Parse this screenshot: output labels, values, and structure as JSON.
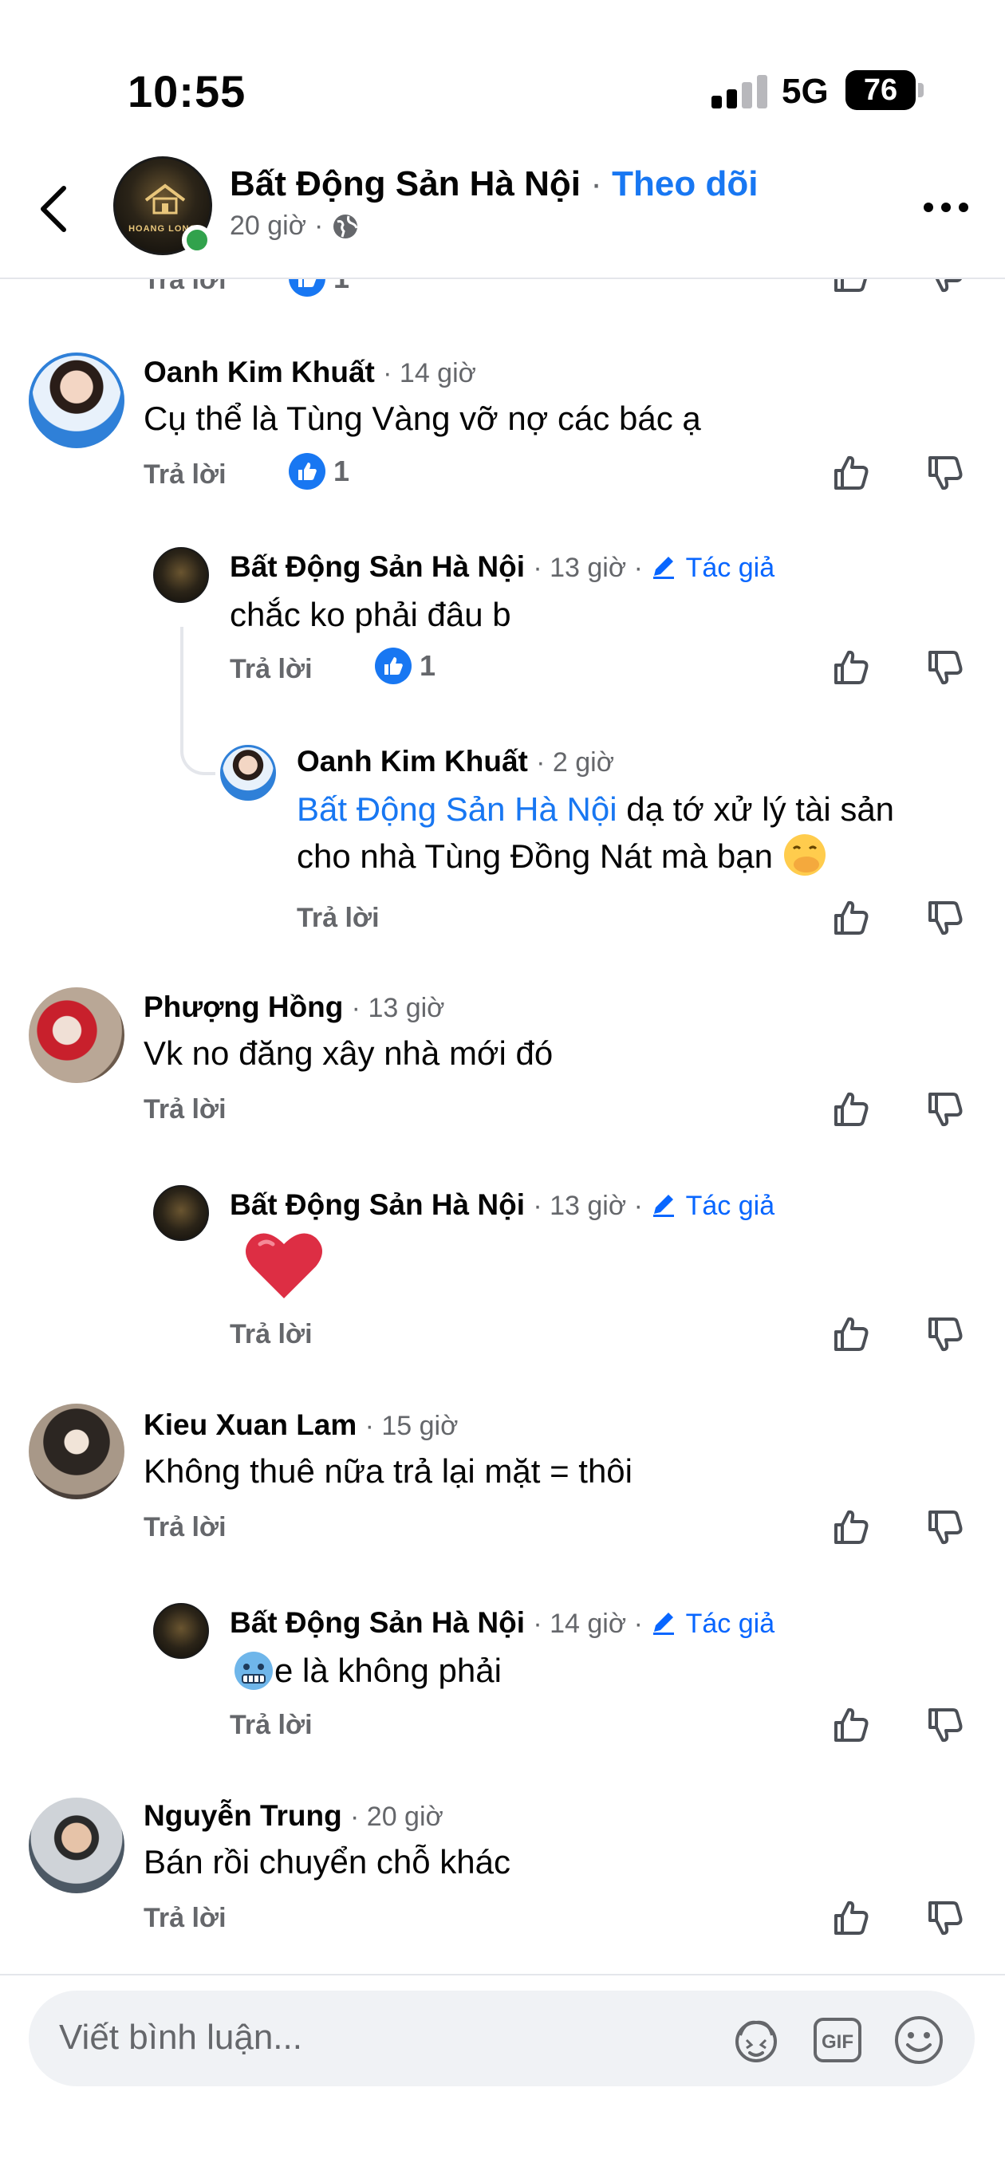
{
  "status_bar": {
    "time": "10:55",
    "network": "5G",
    "battery": "76"
  },
  "header": {
    "page_name": "Bất Động Sản Hà Nội",
    "separator": " · ",
    "follow_label": "Theo dõi",
    "age": "20 giờ",
    "meta_separator": "·",
    "avatar_brand": "HOANG LONG",
    "online_color": "#31a24c"
  },
  "comments": [
    {
      "author": "Oanh Kim Khuất",
      "time": "14 giờ",
      "text": "Cụ thể là Tùng Vàng vỡ nợ các bác ạ",
      "reply_label": "Trả lời",
      "likes": "1",
      "replies": [
        {
          "author": "Bất Động Sản Hà Nội",
          "time": "13 giờ",
          "badge": "Tác giả",
          "text": "chắc ko phải đâu b",
          "reply_label": "Trả lời",
          "likes": "1"
        },
        {
          "author": "Oanh Kim Khuất",
          "time": "2 giờ",
          "mention": "Bất Động Sản Hà Nội",
          "text_line1": "dạ tớ xử lý tài sản",
          "text_line2": "cho nhà Tùng Đồng Nát mà bạn",
          "reply_label": "Trả lời"
        }
      ]
    },
    {
      "author": "Phượng Hồng",
      "time": "13 giờ",
      "text": "Vk no đăng xây nhà mới đó",
      "reply_label": "Trả lời",
      "replies": [
        {
          "author": "Bất Động Sản Hà Nội",
          "time": "13 giờ",
          "badge": "Tác giả",
          "reply_label": "Trả lời"
        }
      ]
    },
    {
      "author": "Kieu Xuan Lam",
      "time": "15 giờ",
      "text": "Không thuê nữa trả lại mặt = thôi",
      "reply_label": "Trả lời",
      "replies": [
        {
          "author": "Bất Động Sản Hà Nội",
          "time": "14 giờ",
          "badge": "Tác giả",
          "text": "e là không phải",
          "reply_label": "Trả lời"
        }
      ]
    },
    {
      "author": "Nguyễn Trung",
      "time": "20 giờ",
      "text": "Bán rồi chuyển chỗ khác",
      "reply_label": "Trả lời"
    }
  ],
  "partial_top_row": {
    "reply_label": "Trả lời",
    "likes": "1"
  },
  "composer": {
    "placeholder": "Viết bình luận..."
  },
  "colors": {
    "accent": "#1877f2",
    "author_badge": "#0866ff",
    "secondary_text": "#65676b",
    "divider": "#e4e6eb",
    "composer_bg": "#f0f2f5"
  }
}
